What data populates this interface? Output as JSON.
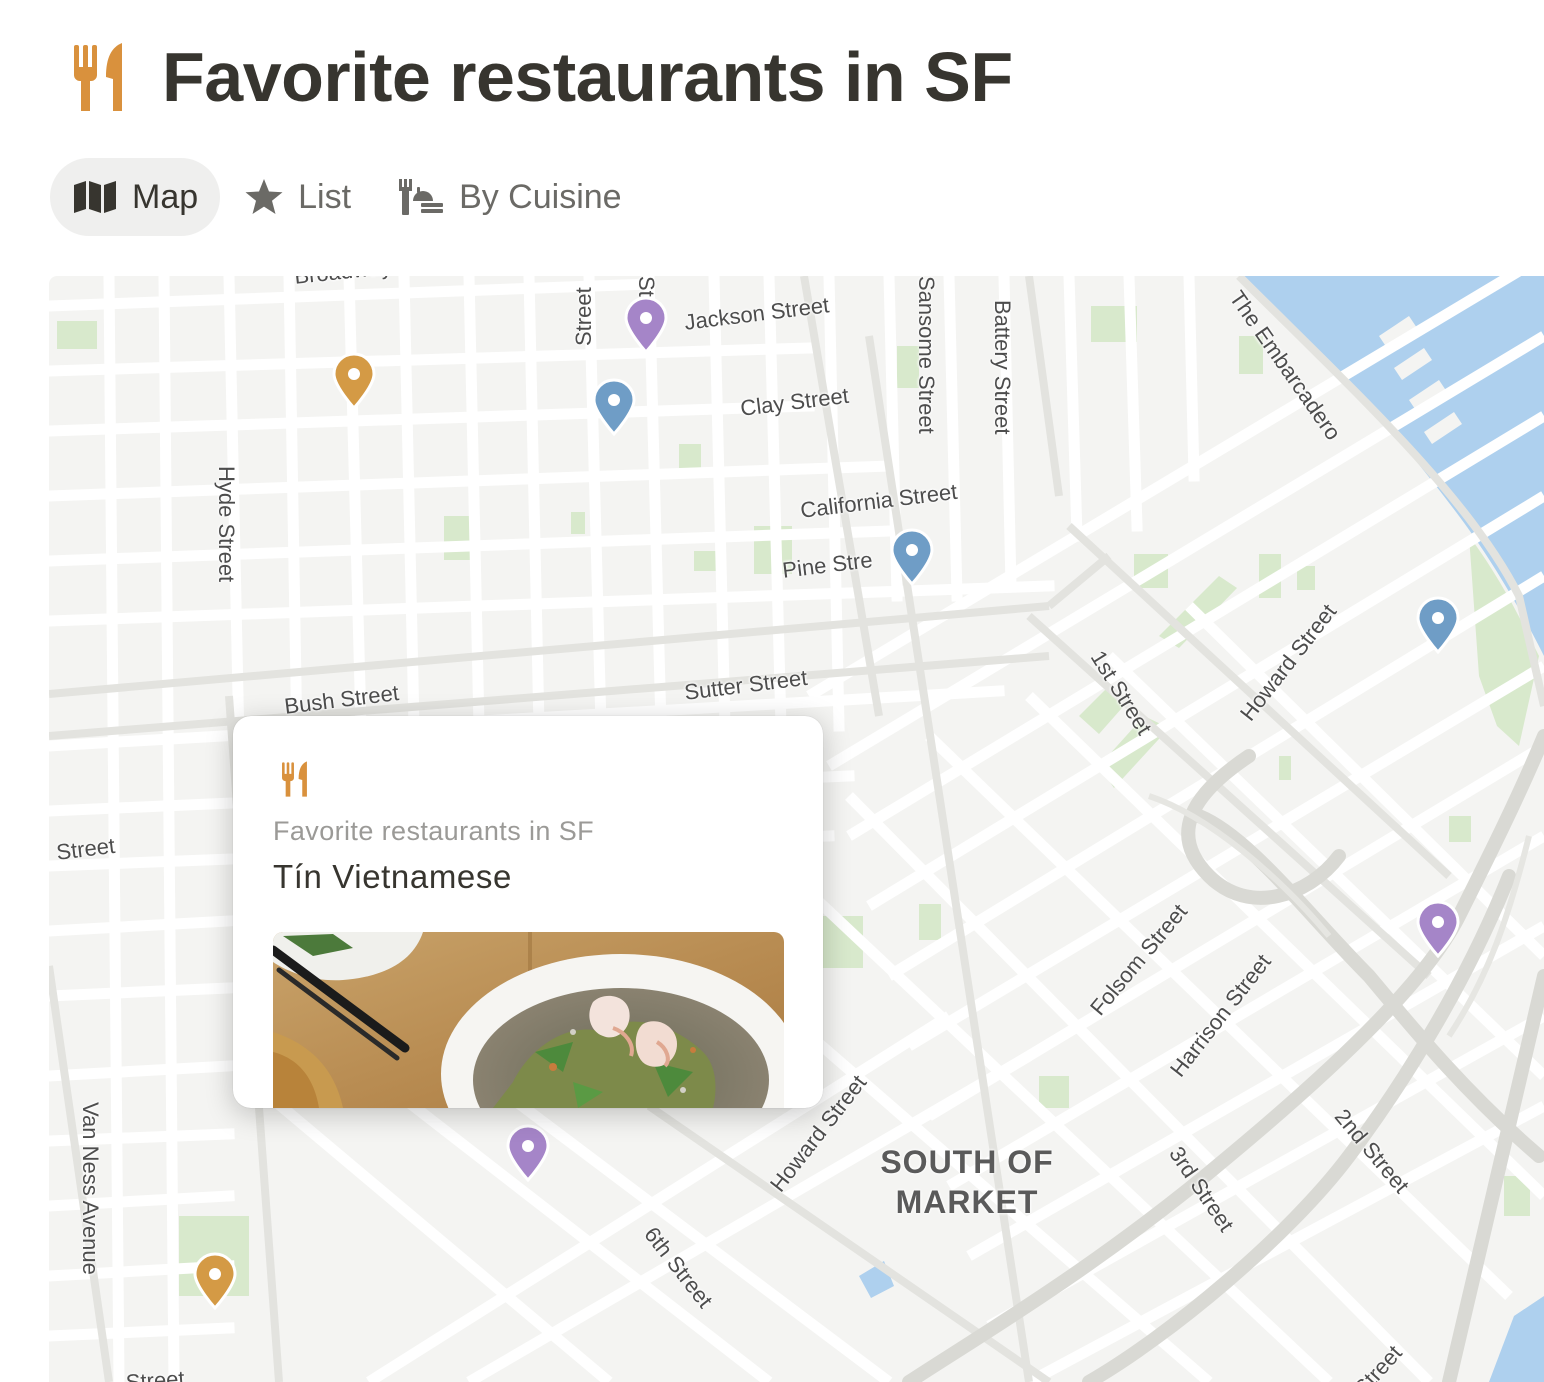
{
  "header": {
    "title": "Favorite restaurants in SF",
    "icon": "fork-knife-icon",
    "icon_color": "#d9913d"
  },
  "tabs": [
    {
      "label": "Map",
      "icon": "map-icon",
      "active": true
    },
    {
      "label": "List",
      "icon": "star-icon",
      "active": false
    },
    {
      "label": "By Cuisine",
      "icon": "table-cuisine-icon",
      "active": false
    }
  ],
  "map": {
    "streets": [
      "Broadway",
      "Street",
      "Street",
      "Jackson Street",
      "Sansome Street",
      "Battery Street",
      "The Embarcadero",
      "Clay Street",
      "Hyde Street",
      "California Street",
      "Pine Stre",
      "Howard Street",
      "1st Street",
      "Sutter Street",
      "Bush Street",
      "Street",
      "Folsom Street",
      "Harrison Street",
      "Howard Street",
      "Van Ness Avenue",
      "6th Street",
      "3rd Street",
      "2nd Street",
      "Street",
      "Street"
    ],
    "district": [
      "SOUTH OF",
      "MARKET"
    ],
    "pin_colors": {
      "gold": "#d49a45",
      "blue": "#6f9dc6",
      "purple": "#a585c8"
    },
    "water_color": "#aed0ee",
    "park_color": "#d8e9cc"
  },
  "popup": {
    "icon": "fork-knife-icon",
    "database": "Favorite restaurants in SF",
    "name": "Tín Vietnamese",
    "photo": "shrimp-noodle-bowl-photo"
  }
}
